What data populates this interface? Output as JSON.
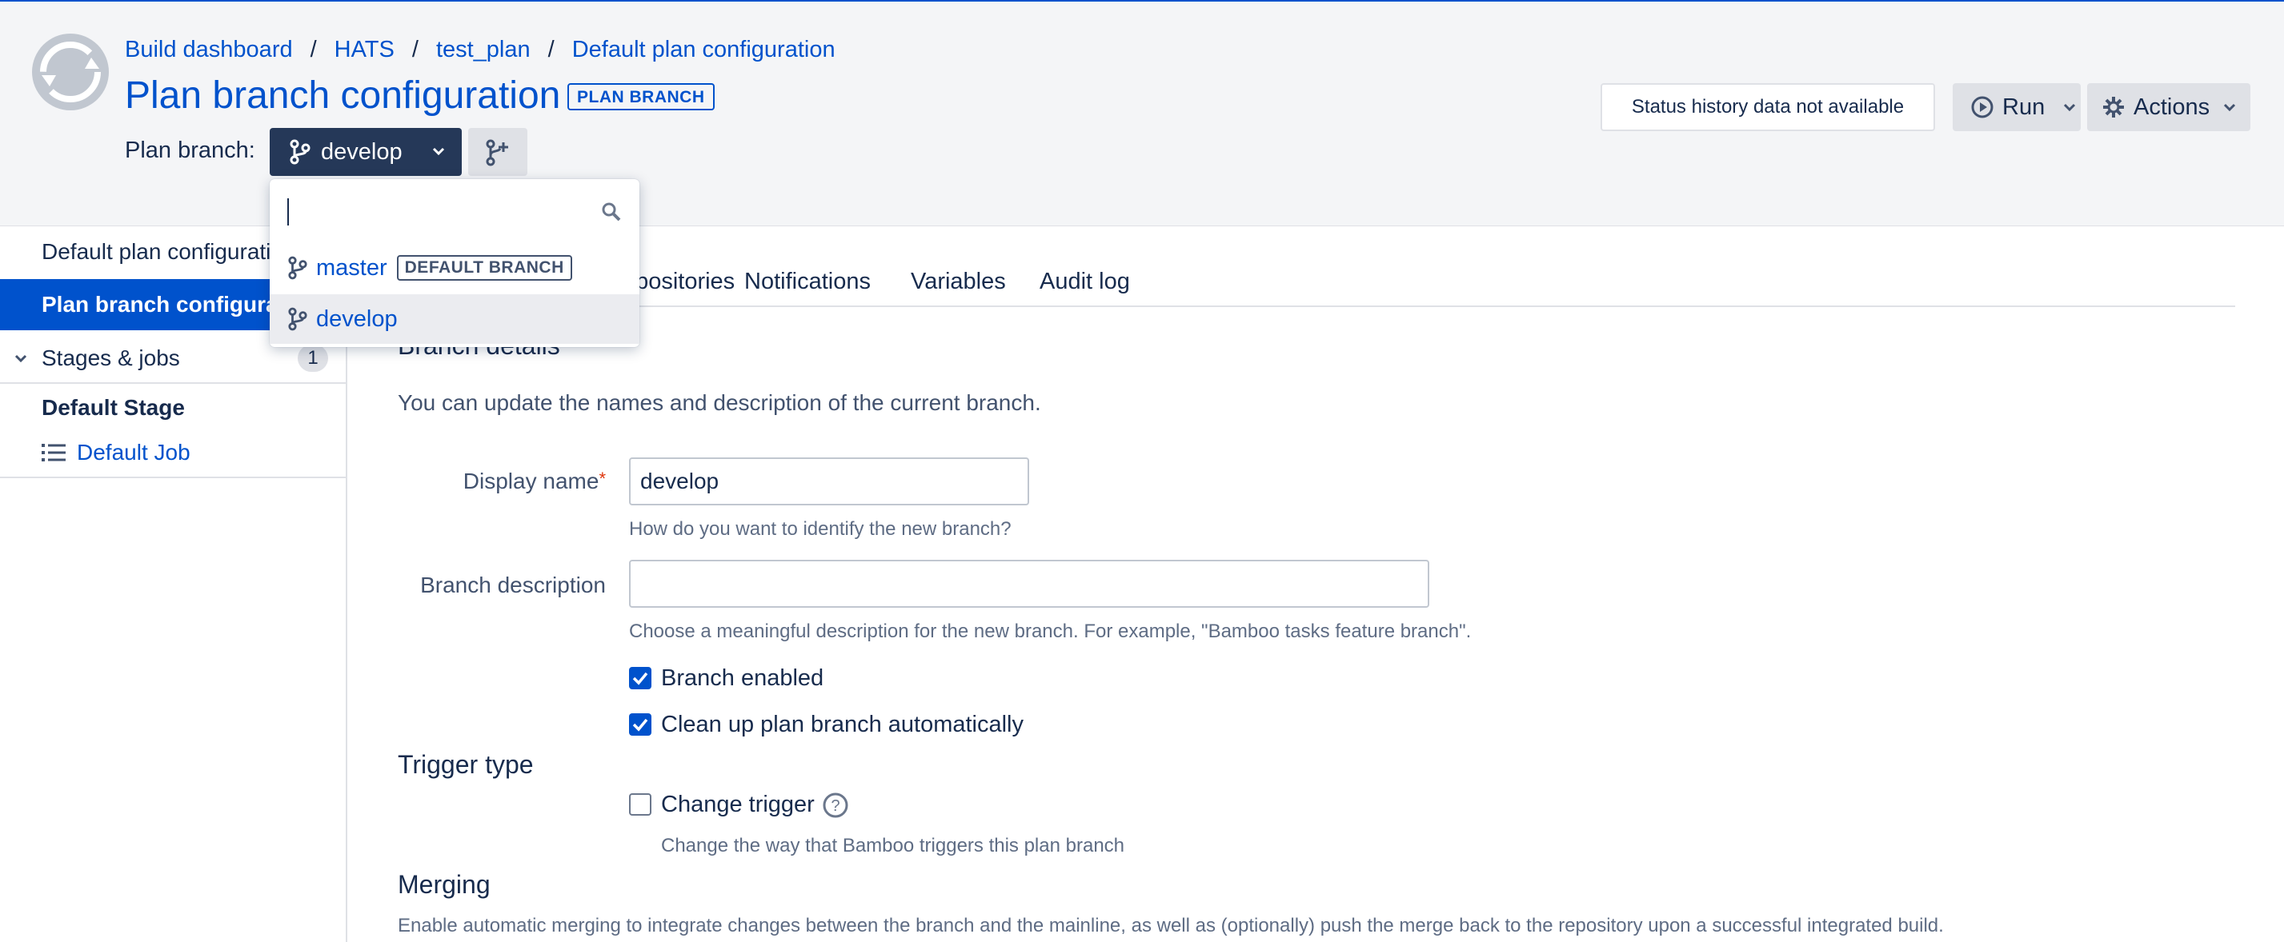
{
  "breadcrumb": {
    "items": [
      "Build dashboard",
      "HATS",
      "test_plan",
      "Default plan configuration"
    ],
    "separator": "/"
  },
  "page": {
    "title": "Plan branch configuration",
    "badge": "PLAN BRANCH"
  },
  "branch_selector": {
    "label": "Plan branch:",
    "current": "develop",
    "add_branch_icon": "branch-add-icon"
  },
  "header_actions": {
    "status": "Status history data not available",
    "run_label": "Run",
    "actions_label": "Actions"
  },
  "branch_dropdown": {
    "search_placeholder": "",
    "items": [
      {
        "name": "master",
        "badge": "DEFAULT BRANCH"
      },
      {
        "name": "develop",
        "badge": ""
      }
    ]
  },
  "sidebar": {
    "items": [
      {
        "label": "Default plan configuration"
      },
      {
        "label": "Plan branch configuration"
      }
    ],
    "stages_label": "Stages & jobs",
    "stages_count": "1",
    "stage_name": "Default Stage",
    "job_name": "Default Job"
  },
  "tabs": [
    "Repositories",
    "Notifications",
    "Variables",
    "Audit log"
  ],
  "branch_details": {
    "heading": "Branch details",
    "intro": "You can update the names and description of the current branch.",
    "display_name_label": "Display name",
    "display_name_value": "develop",
    "display_name_help": "How do you want to identify the new branch?",
    "description_label": "Branch description",
    "description_value": "",
    "description_help": "Choose a meaningful description for the new branch. For example, \"Bamboo tasks feature branch\".",
    "branch_enabled_label": "Branch enabled",
    "branch_enabled": true,
    "cleanup_label": "Clean up plan branch automatically",
    "cleanup": true
  },
  "trigger": {
    "heading": "Trigger type",
    "change_trigger_label": "Change trigger",
    "change_trigger": false,
    "help": "Change the way that Bamboo triggers this plan branch"
  },
  "merging": {
    "heading": "Merging",
    "description": "Enable automatic merging to integrate changes between the branch and the mainline, as well as (optionally) push the merge back to the repository upon a successful integrated build."
  },
  "colors": {
    "accent": "#0052cc",
    "dark_button": "#253858",
    "header_bg": "#f4f5f7"
  }
}
